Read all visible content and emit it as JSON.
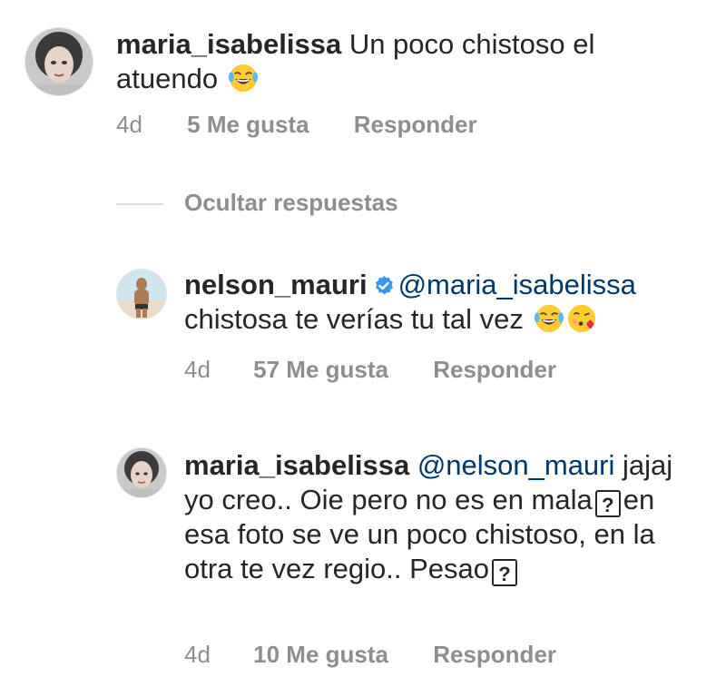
{
  "comments": [
    {
      "username": "maria_isabelissa",
      "text": "Un poco chistoso el atuendo",
      "emoji": [
        "tears-of-joy-emoji"
      ],
      "time": "4d",
      "likes": "5 Me gusta",
      "reply": "Responder"
    },
    {
      "username": "nelson_mauri",
      "verified": true,
      "mention": "@maria_isabelissa",
      "text": "chistosa te verías tu tal vez",
      "emoji": [
        "tears-of-joy-emoji",
        "face-blowing-kiss-emoji"
      ],
      "time": "4d",
      "likes": "57 Me gusta",
      "reply": "Responder"
    },
    {
      "username": "maria_isabelissa",
      "mention": "@nelson_mauri",
      "text_part1": "jajaj yo creo.. Oie pero no es en mala",
      "text_part2": "en esa foto se ve un poco chistoso, en la otra te vez regio.. Pesao",
      "unknown_glyph": "?",
      "time": "4d",
      "likes": "10 Me gusta",
      "reply": "Responder"
    }
  ],
  "hide_replies_label": "Ocultar respuestas",
  "colors": {
    "text": "#262626",
    "meta": "#8e8e8e",
    "mention": "#00376b",
    "verified": "#3897f0",
    "divider": "#dbdbdb"
  }
}
